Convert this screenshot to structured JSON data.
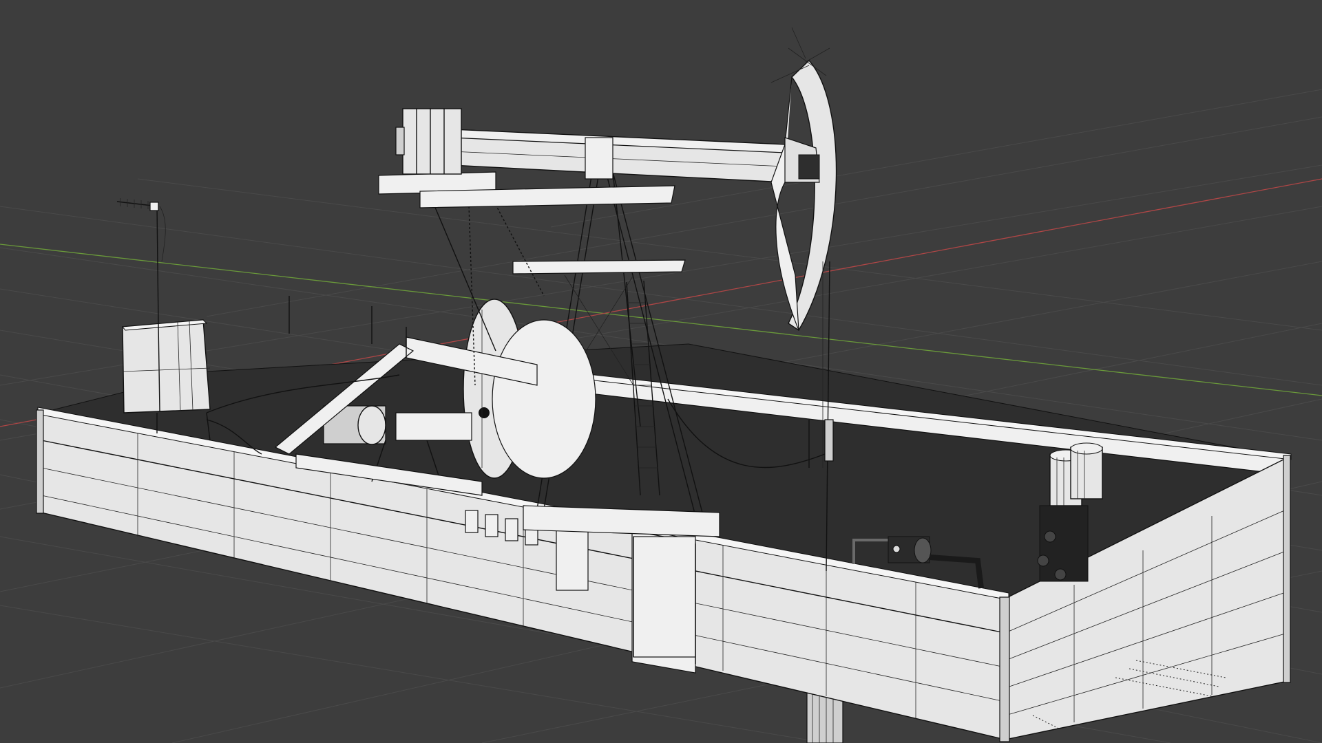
{
  "viewport": {
    "background_color": "#3d3d3d",
    "grid_color": "#4a4a4a",
    "x_axis_color": "#b04646",
    "y_axis_color": "#6a9a3a"
  },
  "scene": {
    "object": "oil-pump-jack-wireframe",
    "shading": "solid-wireframe"
  }
}
